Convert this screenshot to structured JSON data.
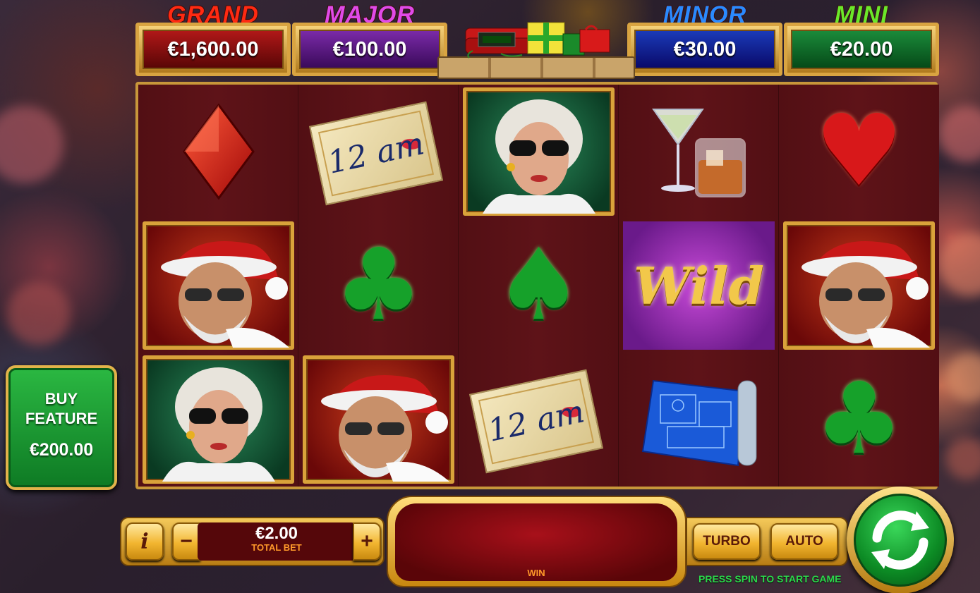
{
  "jackpots": [
    {
      "name": "GRAND",
      "amount": "€1,600.00",
      "title_color": "#ff2a12",
      "box_color": "#8a0a0a"
    },
    {
      "name": "MAJOR",
      "amount": "€100.00",
      "title_color": "#e04ae8",
      "box_color": "#5a1a7a"
    },
    {
      "name": "MINOR",
      "amount": "€30.00",
      "title_color": "#2a8aff",
      "box_color": "#0a1a7a"
    },
    {
      "name": "MINI",
      "amount": "€20.00",
      "title_color": "#6ae82a",
      "box_color": "#0a5a1a"
    }
  ],
  "reels": [
    [
      "red-diamond",
      "santa",
      "blonde-woman"
    ],
    [
      "note-12am",
      "green-club",
      "santa"
    ],
    [
      "blonde-woman",
      "green-spade",
      "note-12am"
    ],
    [
      "cocktails",
      "wild",
      "blueprint"
    ],
    [
      "red-heart",
      "santa",
      "green-club"
    ]
  ],
  "symbols": {
    "note_text": "12 am",
    "wild_text": "Wild"
  },
  "buy_feature": {
    "line1": "BUY",
    "line2": "FEATURE",
    "price": "€200.00"
  },
  "controls": {
    "info_label": "i",
    "minus_label": "−",
    "plus_label": "+",
    "bet_value": "€2.00",
    "bet_label": "TOTAL BET",
    "win_label": "WIN",
    "turbo_label": "TURBO",
    "auto_label": "AUTO",
    "hint": "PRESS SPIN TO START GAME"
  }
}
